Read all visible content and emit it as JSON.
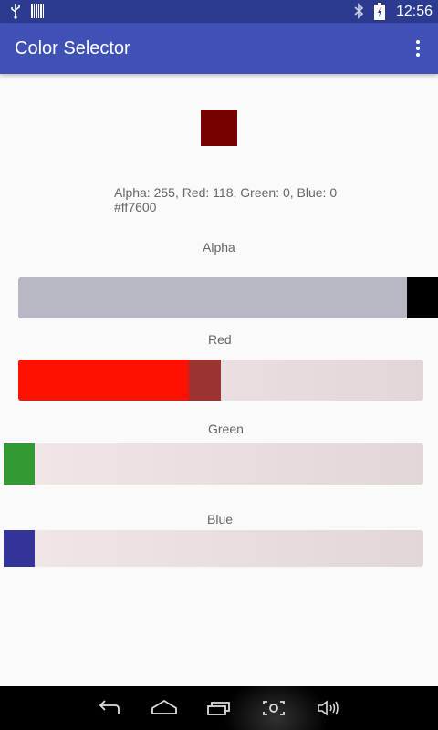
{
  "status_bar": {
    "time": "12:56",
    "icons": [
      "usb-icon",
      "barcode-icon",
      "bluetooth-icon",
      "battery-icon"
    ]
  },
  "app_bar": {
    "title": "Color Selector",
    "menu_icon": "overflow-menu-icon"
  },
  "preview": {
    "color": "#760000"
  },
  "info": {
    "line1": "Alpha: 255, Red: 118, Green: 0, Blue: 0",
    "line2": "#ff7600"
  },
  "sliders": {
    "alpha": {
      "label": "Alpha",
      "value": 255,
      "max": 255
    },
    "red": {
      "label": "Red",
      "value": 118,
      "max": 255
    },
    "green": {
      "label": "Green",
      "value": 0,
      "max": 255
    },
    "blue": {
      "label": "Blue",
      "value": 0,
      "max": 255
    }
  },
  "colors": {
    "app_bar": "#3f51b5",
    "status_bar": "#2c3b8f",
    "red_fill": "#ff1100",
    "green_thumb": "#339933",
    "blue_thumb": "#333399"
  },
  "nav_bar": {
    "icons": [
      "back-icon",
      "home-icon",
      "recent-apps-icon",
      "screenshot-icon",
      "volume-icon"
    ]
  }
}
